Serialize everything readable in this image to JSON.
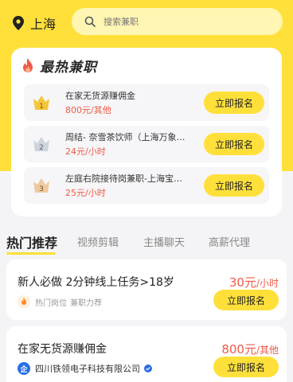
{
  "header": {
    "location": "上海",
    "search_placeholder": "搜索兼职"
  },
  "hot_jobs": {
    "title": "最热兼职",
    "items": [
      {
        "rank": "1",
        "title": "在家无货源赚佣金",
        "price": "800元/其他",
        "button": "立即报名"
      },
      {
        "rank": "2",
        "title": "周结- 奈雪茶饮师（上海万象…",
        "price": "24元/小时",
        "button": "立即报名"
      },
      {
        "rank": "3",
        "title": "左庭右院接待岗兼职-上海宝…",
        "price": "25元/小时",
        "button": "立即报名"
      }
    ]
  },
  "tabs": [
    "热门推荐",
    "视频剪辑",
    "主播聊天",
    "高薪代理"
  ],
  "jobs": [
    {
      "title": "新人必做 2分钟线上任务>18岁",
      "pay_value": "30元",
      "pay_unit": "/小时",
      "tag1": "热门岗位",
      "tag2": "兼职力荐",
      "button": "立即报名"
    },
    {
      "title": "在家无货源赚佣金",
      "pay_value": "800元",
      "pay_unit": "/其他",
      "company": "四川铁领电子科技有限公司",
      "company_icon": "企",
      "button": "立即报名"
    }
  ],
  "colors": {
    "accent": "#ffe03a",
    "price": "#f05a47",
    "verified": "#2b6de9"
  }
}
